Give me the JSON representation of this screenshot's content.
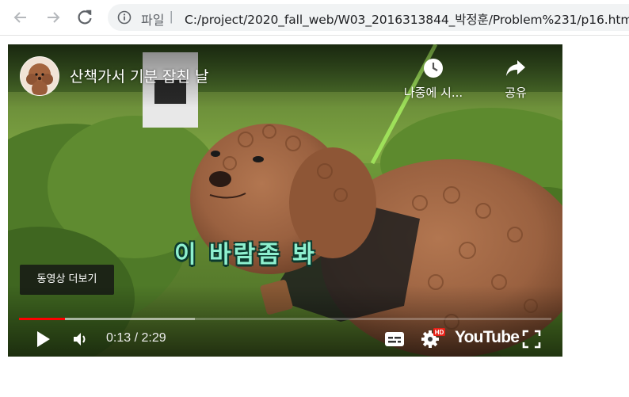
{
  "browser": {
    "scheme_label": "파일",
    "url": "C:/project/2020_fall_web/W03_2016313844_박정훈/Problem%231/p16.html"
  },
  "video": {
    "title": "산책가서 기분 잡친 날",
    "watch_later_label": "나중에 시...",
    "share_label": "공유",
    "subtitle": "이 바람좀 봐",
    "more_videos_label": "동영상 더보기",
    "time_display": "0:13 / 2:29",
    "progress_fraction": 0.087,
    "buffered_fraction": 0.33,
    "brand_label": "YouTube",
    "settings_badge": "HD",
    "colors": {
      "progress": "#ff0000",
      "subtitle": "#8ef0cf",
      "hd_badge": "#e62117"
    }
  },
  "icons": {
    "back": "arrow-left-icon",
    "forward": "arrow-right-icon",
    "reload": "reload-icon",
    "info": "info-icon",
    "watch_later": "clock-icon",
    "share": "share-arrow-icon",
    "play": "play-icon",
    "volume": "volume-icon",
    "captions": "captions-icon",
    "settings": "gear-icon",
    "fullscreen": "fullscreen-icon"
  }
}
